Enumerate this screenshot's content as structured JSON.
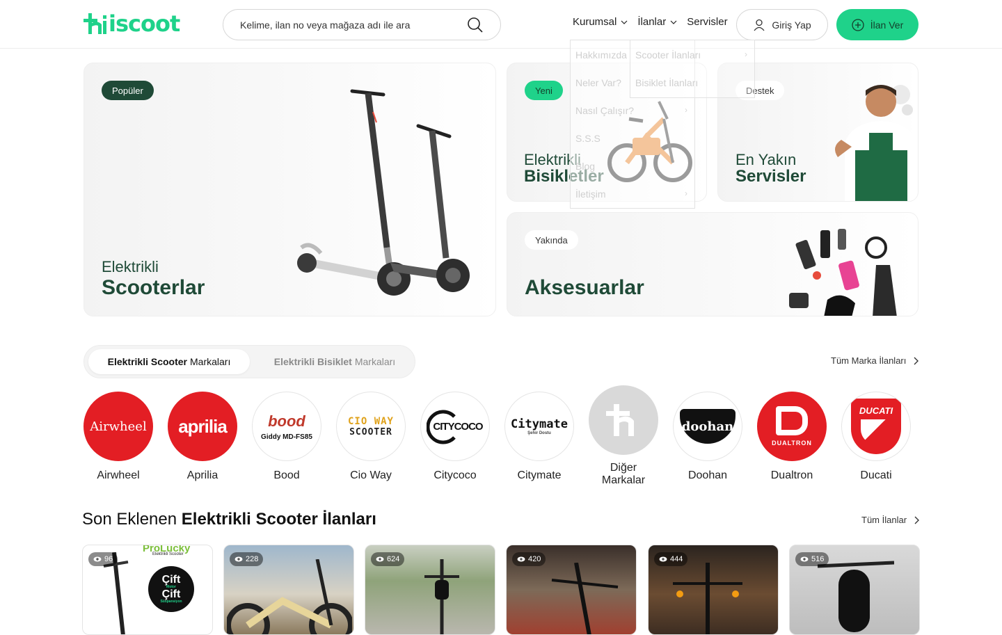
{
  "header": {
    "logo_text": "hiscoot",
    "search_placeholder": "Kelime, ilan no veya mağaza adı ile ara",
    "nav": [
      {
        "label": "Kurumsal",
        "has_dropdown": true
      },
      {
        "label": "İlanlar",
        "has_dropdown": true
      },
      {
        "label": "Servisler",
        "has_dropdown": false
      }
    ],
    "login_label": "Giriş Yap",
    "post_ad_label": "İlan Ver",
    "accent_color": "#1fd28a",
    "dark_color": "#1f4a37"
  },
  "dropdowns": {
    "kurumsal_items": [
      "Hakkımızda",
      "Neler Var?",
      "Nasıl Çalışır?",
      "S.S.S",
      "Blog",
      "İletişim"
    ],
    "ilanlar_items": [
      "Scooter İlanları",
      "Bisiklet İlanları"
    ]
  },
  "hero": {
    "scooter": {
      "badge": "Popüler",
      "title_light": "Elektrikli",
      "title_bold": "Scooterlar"
    },
    "bike": {
      "badge": "Yeni",
      "title_light": "Elektrikli",
      "title_bold": "Bisikletler"
    },
    "service": {
      "badge": "Destek",
      "title_light": "En Yakın",
      "title_bold": "Servisler"
    },
    "accessory": {
      "badge": "Yakında",
      "title_bold": "Aksesuarlar"
    }
  },
  "brands_section": {
    "tab_active_bold": "Elektrikli Scooter",
    "tab_active_rest": "Markaları",
    "tab_inactive_bold": "Elektrikli Bisiklet",
    "tab_inactive_rest": "Markaları",
    "all_link": "Tüm Marka İlanları",
    "brands": [
      {
        "name": "Airwheel",
        "logo_text": "Airwheel",
        "bg": "#e31e24",
        "fg": "#ffffff"
      },
      {
        "name": "Aprilia",
        "logo_text": "aprilia",
        "bg": "#e31e24",
        "fg": "#ffffff"
      },
      {
        "name": "Bood",
        "logo_text": "bood",
        "sub_text": "Giddy MD-FS85",
        "bg": "#ffffff",
        "fg": "#c0392b"
      },
      {
        "name": "Cio Way",
        "logo_text": "CIO WAY",
        "sub_text": "SCOOTER",
        "bg": "#ffffff",
        "fg": "#e0a21b"
      },
      {
        "name": "Citycoco",
        "logo_text": "CITYCOCO",
        "bg": "#ffffff",
        "fg": "#111111"
      },
      {
        "name": "Citymate",
        "logo_text": "Citymate",
        "sub_text": "Şehir Dostu",
        "bg": "#ffffff",
        "fg": "#111111"
      },
      {
        "name": "Diğer Markalar",
        "logo_text": "",
        "bg": "#d9d9d9",
        "fg": "#ffffff"
      },
      {
        "name": "Doohan",
        "logo_text": "doohan",
        "bg": "#ffffff",
        "fg": "#ffffff"
      },
      {
        "name": "Dualtron",
        "logo_text": "DUALTRON",
        "bg": "#e31e24",
        "fg": "#ffffff"
      },
      {
        "name": "Ducati",
        "logo_text": "DUCATI",
        "bg": "#ffffff",
        "fg": "#ffffff"
      }
    ]
  },
  "latest": {
    "title_light": "Son Eklenen",
    "title_bold": "Elektrikli Scooter İlanları",
    "all_link": "Tüm İlanlar",
    "listings": [
      {
        "views": "96",
        "overlay_title": "ProLucky",
        "overlay_sub": "Elektrikli Scooter",
        "badge_line1": "Çift",
        "badge_line2": "Motor",
        "badge_line3": "Çift",
        "badge_line4": "Süspansiyon"
      },
      {
        "views": "228"
      },
      {
        "views": "624"
      },
      {
        "views": "420"
      },
      {
        "views": "444"
      },
      {
        "views": "516"
      }
    ]
  }
}
